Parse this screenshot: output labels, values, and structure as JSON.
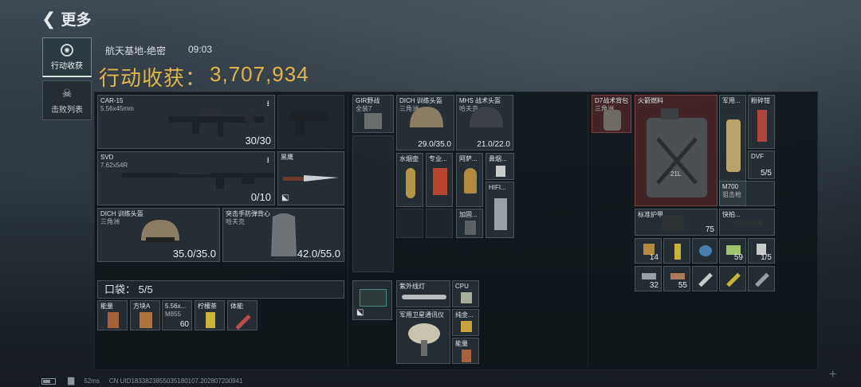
{
  "header": {
    "back_label": "更多"
  },
  "sidebar": [
    {
      "label": "行动收获",
      "active": true,
      "icon": "target-icon"
    },
    {
      "label": "击败列表",
      "active": false,
      "icon": "skull-icon"
    }
  ],
  "raid": {
    "location": "航天基地-绝密",
    "time": "09:03",
    "title": "行动收获：",
    "value": "3,707,934",
    "value_color": "#e3b44a"
  },
  "loadout": {
    "primary": {
      "name": "CAR-15",
      "ammo": "5.56x45mm",
      "count": "30/30"
    },
    "secondary": {
      "name": "SVD",
      "ammo": "7.62x54R",
      "count": "0/10"
    },
    "melee": {
      "name": "黑鹰"
    },
    "helmet": {
      "name": "DICH 训练头盔",
      "sub": "三角洲",
      "durability": "35.0/35.0"
    },
    "armor": {
      "name": "突击手防弹背心",
      "sub": "哈夫克",
      "durability": "42.0/55.0"
    }
  },
  "pocket": {
    "label": "口袋：",
    "count": "5/5",
    "items": [
      {
        "label": "能量"
      },
      {
        "label": "方块A"
      },
      {
        "label": "5.56x...",
        "sub": "M855",
        "count": "60"
      },
      {
        "label": "柠檬茶"
      },
      {
        "label": "体能"
      }
    ]
  },
  "rig": [
    {
      "label": "GIR野战",
      "sub": "全装7"
    },
    {
      "label": "DICH 训练头盔",
      "sub": "三角洲",
      "value": "29.0/35.0"
    },
    {
      "label": "MHS 战术头盔",
      "sub": "哈夫克",
      "value": "21.0/22.0"
    },
    {
      "label": "水烟壶"
    },
    {
      "label": "专业..."
    },
    {
      "label": "阿萨..."
    },
    {
      "label": "鼻烟..."
    },
    {
      "label": "加固..."
    },
    {
      "label": "HIFI..."
    },
    {
      "label": "紫外线灯"
    },
    {
      "label": "CPU"
    },
    {
      "label": "军用卫星通讯仪"
    },
    {
      "label": "纯金..."
    },
    {
      "label": "能量"
    }
  ],
  "backpack": {
    "label": "D7战术背包",
    "sub": "三角洲"
  },
  "loot": [
    {
      "label": "火箭燃料",
      "sub": "21L"
    },
    {
      "label": "军用..."
    },
    {
      "label": "粉碎钳"
    },
    {
      "label": "DVF",
      "count": "5/5"
    },
    {
      "label": "M700",
      "sub": "狙击枪"
    },
    {
      "label": "标准护甲",
      "count": "75"
    },
    {
      "label": "快拍...",
      "sub": ""
    },
    {
      "count": "14"
    },
    {
      "count": ""
    },
    {
      "count": ""
    },
    {
      "count": "59"
    },
    {
      "count": "1/5"
    },
    {
      "count": "32"
    },
    {
      "count": "55"
    },
    {
      "count": ""
    },
    {
      "count": ""
    },
    {
      "count": ""
    }
  ],
  "status": {
    "ping": "52ms",
    "uid": "CN UID1833823855035180107.202807200941"
  }
}
